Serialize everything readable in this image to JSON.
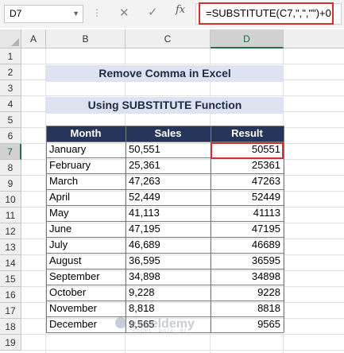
{
  "formula_bar": {
    "name_box": "D7",
    "cancel_icon": "✕",
    "enter_icon": "✓",
    "fx_label": "fx",
    "formula": "=SUBSTITUTE(C7,\",\",\"\")+0"
  },
  "columns": [
    "A",
    "B",
    "C",
    "D"
  ],
  "rows": [
    "1",
    "2",
    "3",
    "4",
    "5",
    "6",
    "7",
    "8",
    "9",
    "10",
    "11",
    "12",
    "13",
    "14",
    "15",
    "16",
    "17",
    "18",
    "19"
  ],
  "selected_column": "D",
  "selected_row": "7",
  "title": "Remove Comma in Excel",
  "subtitle": "Using SUBSTITUTE Function",
  "table": {
    "headers": [
      "Month",
      "Sales",
      "Result"
    ],
    "rows": [
      [
        "January",
        "50,551",
        "50551"
      ],
      [
        "February",
        "25,361",
        "25361"
      ],
      [
        "March",
        "47,263",
        "47263"
      ],
      [
        "April",
        "52,449",
        "52449"
      ],
      [
        "May",
        "41,113",
        "41113"
      ],
      [
        "June",
        "47,195",
        "47195"
      ],
      [
        "July",
        "46,689",
        "46689"
      ],
      [
        "August",
        "36,595",
        "36595"
      ],
      [
        "September",
        "34,898",
        "34898"
      ],
      [
        "October",
        "9,228",
        "9228"
      ],
      [
        "November",
        "8,818",
        "8818"
      ],
      [
        "December",
        "9,565",
        "9565"
      ]
    ]
  },
  "watermark": {
    "brand": "exceldemy",
    "tagline": "EXCEL · DATA · BI"
  },
  "colors": {
    "header_fill": "#26355a",
    "banner_fill": "#dde3f0",
    "highlight": "#d0312d",
    "excel_green": "#217346"
  }
}
